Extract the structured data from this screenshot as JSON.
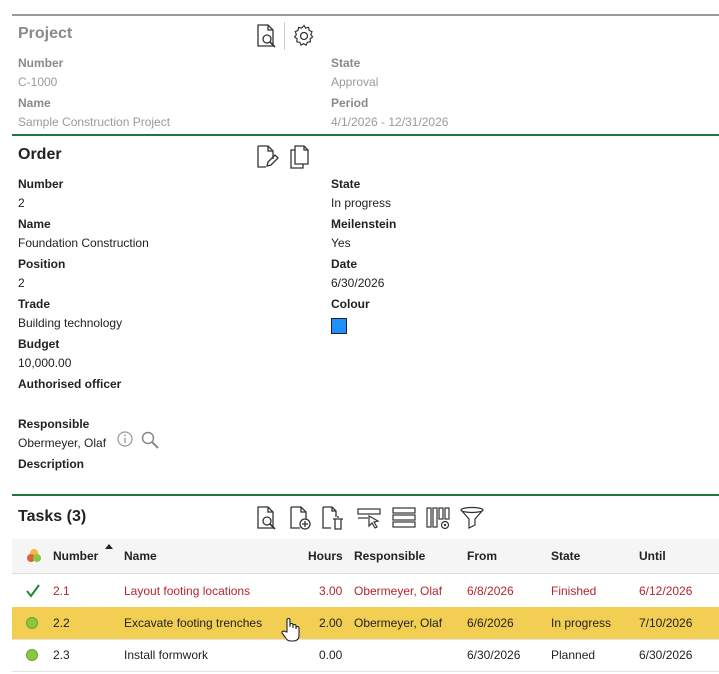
{
  "project": {
    "title": "Project",
    "number_label": "Number",
    "number": "C-1000",
    "name_label": "Name",
    "name": "Sample Construction Project",
    "state_label": "State",
    "state": "Approval",
    "period_label": "Period",
    "period": "4/1/2026 - 12/31/2026"
  },
  "order": {
    "title": "Order",
    "number_label": "Number",
    "number": "2",
    "name_label": "Name",
    "name": "Foundation Construction",
    "position_label": "Position",
    "position": "2",
    "trade_label": "Trade",
    "trade": "Building technology",
    "budget_label": "Budget",
    "budget": "10,000.00",
    "authorised_label": "Authorised officer",
    "responsible_label": "Responsible",
    "responsible": "Obermeyer, Olaf",
    "description_label": "Description",
    "state_label": "State",
    "state": "In progress",
    "milestone_label": "Meilenstein",
    "milestone": "Yes",
    "date_label": "Date",
    "date": "6/30/2026",
    "colour_label": "Colour",
    "colour": "#1e90ff"
  },
  "tasks": {
    "title": "Tasks (3)",
    "columns": {
      "number": "Number",
      "name": "Name",
      "hours": "Hours",
      "responsible": "Responsible",
      "from": "From",
      "state": "State",
      "until": "Until"
    },
    "rows": [
      {
        "number": "2.1",
        "name": "Layout footing locations",
        "hours": "3.00",
        "responsible": "Obermeyer, Olaf",
        "from": "6/8/2026",
        "state": "Finished",
        "until": "6/12/2026"
      },
      {
        "number": "2.2",
        "name": "Excavate footing trenches",
        "hours": "2.00",
        "responsible": "Obermeyer, Olaf",
        "from": "6/6/2026",
        "state": "In progress",
        "until": "7/10/2026"
      },
      {
        "number": "2.3",
        "name": "Install formwork",
        "hours": "0.00",
        "responsible": "",
        "from": "6/30/2026",
        "state": "Planned",
        "until": "6/30/2026"
      }
    ]
  },
  "colors": {
    "accent_green": "#1f7a3a",
    "selected_row": "#f2cf52",
    "finished_red": "#b3262e",
    "status_dot": "#8cc63f"
  }
}
